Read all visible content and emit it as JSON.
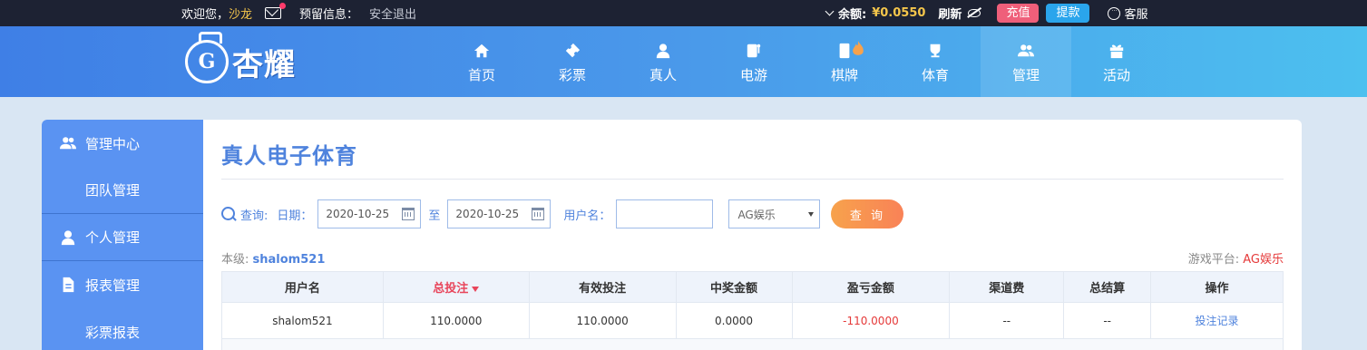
{
  "topbar": {
    "welcome": "欢迎您，",
    "username": "沙龙",
    "reserve_info": "预留信息：",
    "logout": "安全退出",
    "balance_label": "余额:",
    "balance_value": "¥0.0550",
    "refresh": "刷新",
    "recharge": "充值",
    "withdraw": "提款",
    "service": "客服"
  },
  "header": {
    "logo_text": "杏耀",
    "logo_mark": "G",
    "nav": [
      {
        "label": "首页",
        "icon": "home-icon"
      },
      {
        "label": "彩票",
        "icon": "ticket-icon"
      },
      {
        "label": "真人",
        "icon": "dealer-icon"
      },
      {
        "label": "电游",
        "icon": "slot-machine-icon"
      },
      {
        "label": "棋牌",
        "icon": "mahjong-icon"
      },
      {
        "label": "体育",
        "icon": "trophy-icon"
      },
      {
        "label": "管理",
        "icon": "users-icon"
      },
      {
        "label": "活动",
        "icon": "gift-icon"
      }
    ],
    "active_nav": "管理"
  },
  "sidebar": {
    "items": [
      {
        "label": "管理中心",
        "icon": "users-icon"
      },
      {
        "label": "团队管理"
      },
      {
        "label": "个人管理",
        "icon": "user-icon"
      },
      {
        "label": "报表管理",
        "icon": "document-icon"
      },
      {
        "label": "彩票报表"
      }
    ]
  },
  "main": {
    "title": "真人电子体育",
    "query": {
      "label": "查询:",
      "date_label": "日期：",
      "date_from": "2020-10-25",
      "to": "至",
      "date_to": "2020-10-25",
      "username_label": "用户名：",
      "username_value": "",
      "platform_selected": "AG娱乐",
      "submit": "查 询"
    },
    "level_label": "本级:",
    "level_user": "shalom521",
    "platform_label": "游戏平台:",
    "platform_value": "AG娱乐",
    "table": {
      "headers": [
        "用户名",
        "总投注",
        "有效投注",
        "中奖金额",
        "盈亏金额",
        "渠道费",
        "总结算",
        "操作"
      ],
      "rows": [
        [
          "shalom521",
          "110.0000",
          "110.0000",
          "0.0000",
          "-110.0000",
          "--",
          "--",
          "投注记录"
        ]
      ]
    }
  }
}
